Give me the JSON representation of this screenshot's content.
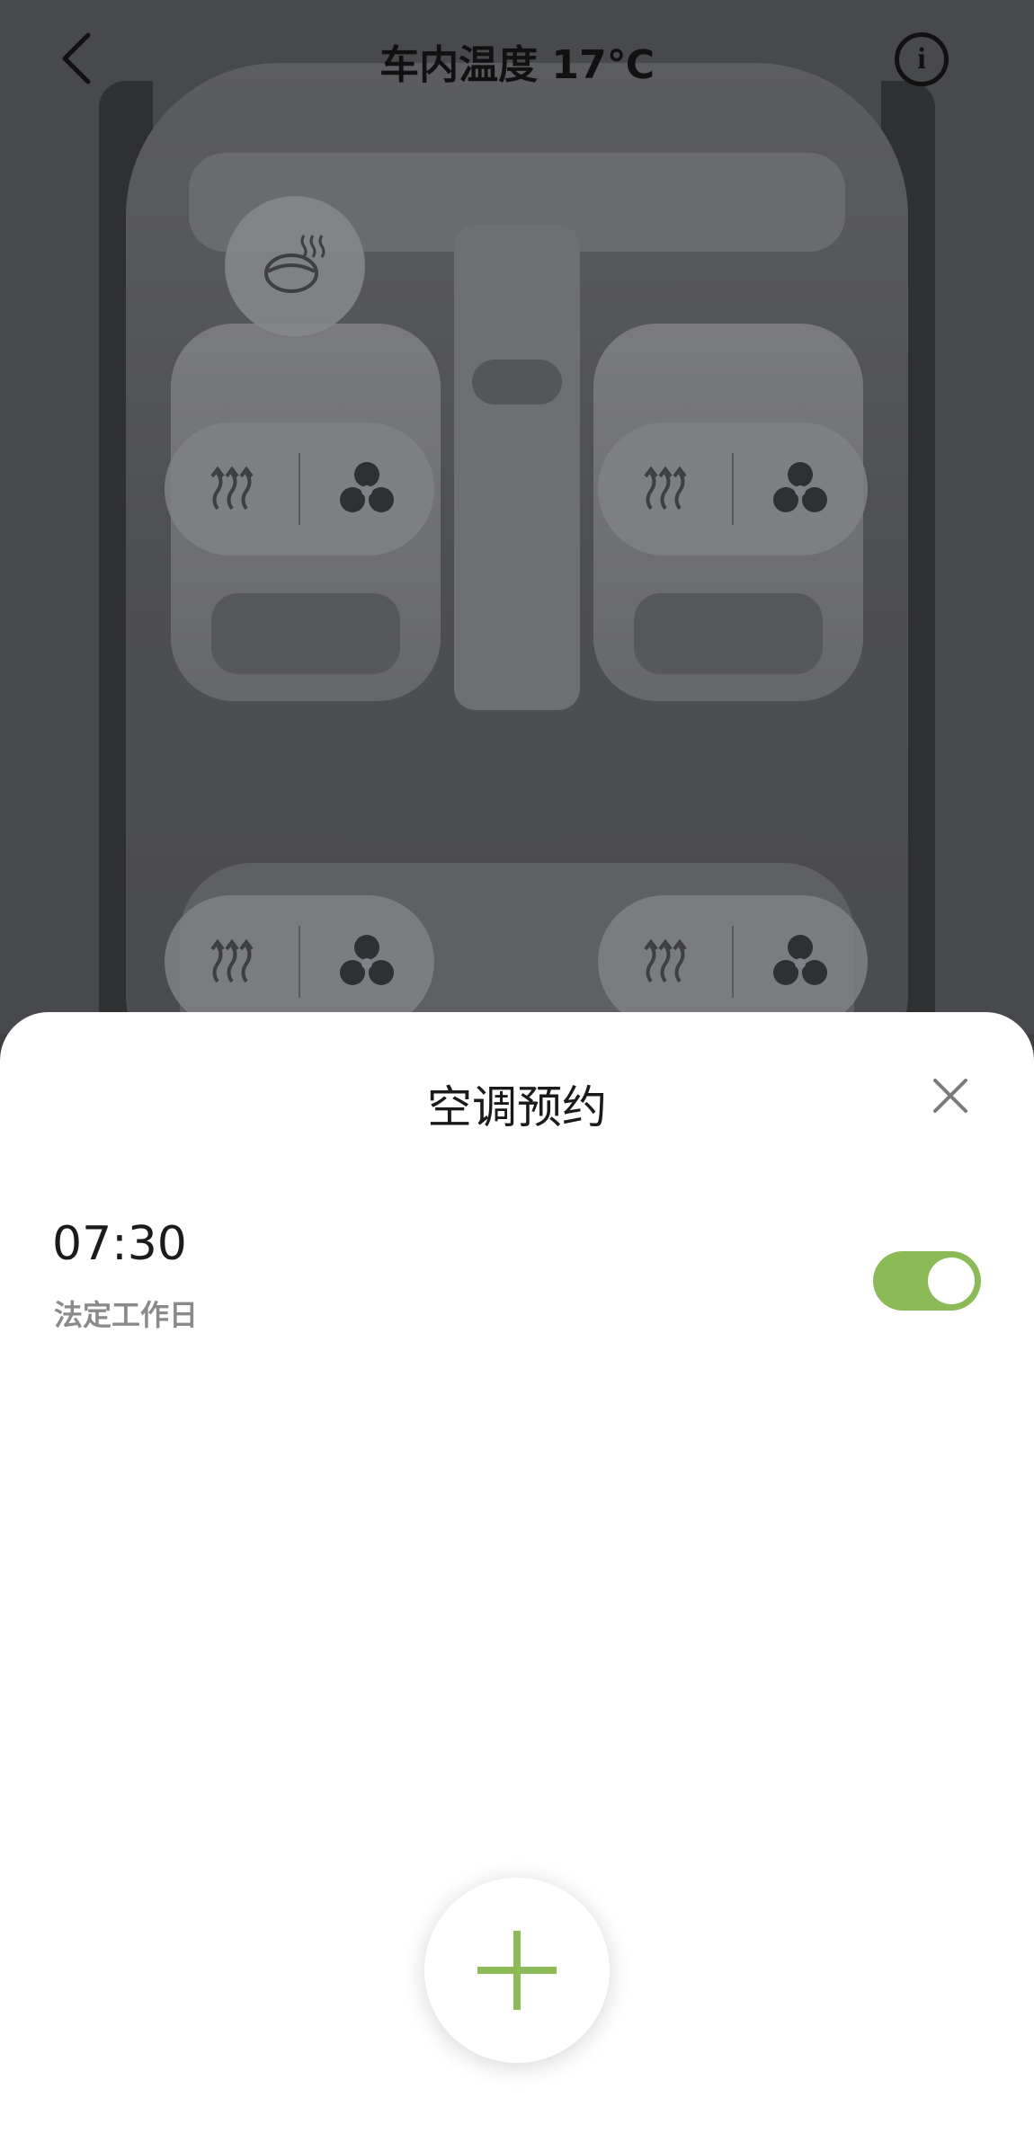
{
  "header": {
    "title": "车内温度 17℃",
    "back_icon": "chevron-left-icon",
    "info_icon": "info-icon",
    "info_glyph": "i"
  },
  "controls": {
    "steering_heat_icon": "steering-wheel-heat-icon",
    "seat_heat_icon": "seat-heat-icon",
    "seat_vent_icon": "fan-icon"
  },
  "sheet": {
    "title": "空调预约",
    "close_icon": "close-icon",
    "schedules": [
      {
        "time": "07:30",
        "days": "法定工作日",
        "enabled": true
      }
    ],
    "add_icon": "plus-icon"
  },
  "colors": {
    "accent": "#8bba57",
    "overlay": "#48494c",
    "sheet_bg": "#ffffff"
  }
}
